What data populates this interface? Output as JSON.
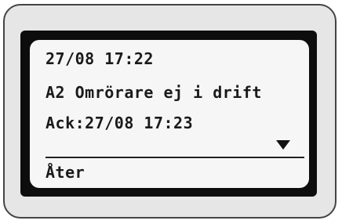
{
  "display": {
    "alarm_time": "27/08 17:22",
    "alarm_message": "A2 Omrörare ej i drift",
    "ack_line": "Ack:27/08 17:23",
    "scroll_icon": "triangle-down-icon",
    "back_label": "Åter"
  },
  "colors": {
    "bezel": "#e6e6e6",
    "frame": "#0d0d0d",
    "screen": "#f6f6f6",
    "text": "#1a1a1a"
  }
}
